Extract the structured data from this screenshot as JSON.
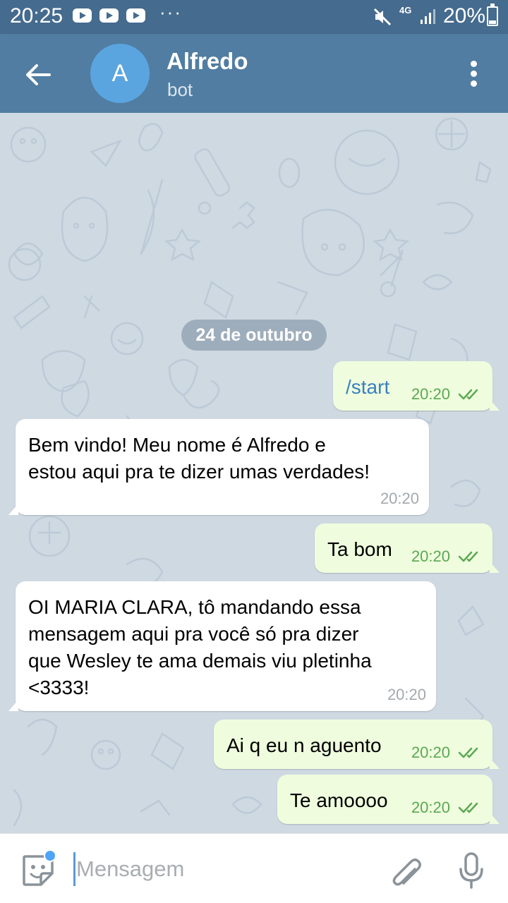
{
  "status_bar": {
    "time": "20:25",
    "network": "4G",
    "battery": "20%",
    "notification_icons": [
      "youtube-icon",
      "youtube-icon",
      "youtube-icon"
    ],
    "more_notifications": "···"
  },
  "header": {
    "avatar_letter": "A",
    "title": "Alfredo",
    "subtitle": "bot",
    "colors": {
      "bar": "#517da2",
      "status": "#456b8f",
      "avatar": "#5aa5e0"
    }
  },
  "date_separator": "24 de outubro",
  "messages": [
    {
      "direction": "out",
      "text": "/start",
      "time": "20:20",
      "read": true
    },
    {
      "direction": "in",
      "text": "Bem vindo! Meu nome é Alfredo e\nestou aqui pra te dizer umas verdades!",
      "time": "20:20"
    },
    {
      "direction": "out",
      "text": "Ta bom",
      "time": "20:20",
      "read": true
    },
    {
      "direction": "in",
      "text": "OI MARIA CLARA, tô mandando essa\nmensagem aqui pra você só pra dizer\nque Wesley te ama demais viu pletinha\n<3333!",
      "time": "20:20"
    },
    {
      "direction": "out",
      "text": "Ai q eu n aguento",
      "time": "20:20",
      "read": true
    },
    {
      "direction": "out",
      "text": "Te amoooo",
      "time": "20:20",
      "read": true
    }
  ],
  "input": {
    "placeholder": "Mensagem",
    "value": ""
  },
  "colors": {
    "outgoing_bubble": "#effdde",
    "incoming_bubble": "#ffffff",
    "chat_bg": "#cfd9e2",
    "ticks": "#5ba853"
  }
}
